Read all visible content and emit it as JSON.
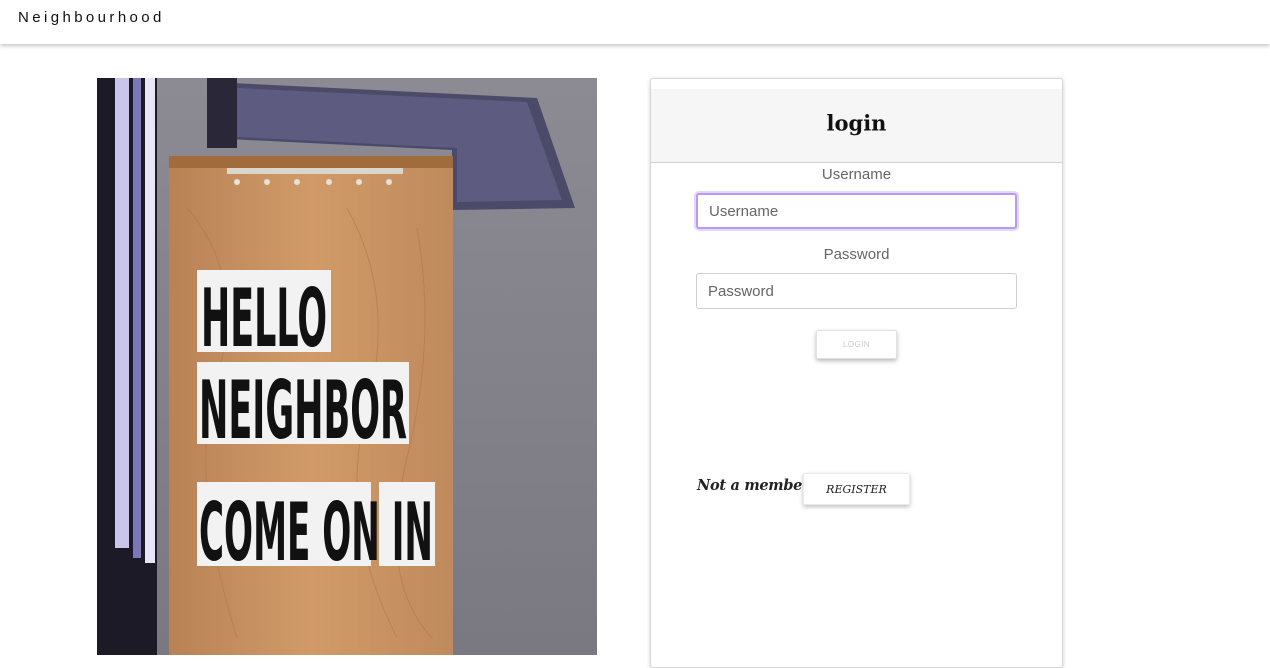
{
  "navbar": {
    "brand": "Neighbourhood"
  },
  "photo": {
    "sign_lines": [
      "HELLO",
      "NEIGHBOR",
      "COME ON IN"
    ]
  },
  "login_card": {
    "title": "login",
    "username": {
      "label": "Username",
      "placeholder": "Username",
      "value": ""
    },
    "password": {
      "label": "Password",
      "placeholder": "Password",
      "value": ""
    },
    "login_button": "LOGIN",
    "register_prompt": "Not a member?",
    "register_button": "REGISTER"
  },
  "colors": {
    "focus_border": "#b99af0",
    "header_bg": "#f6f6f6",
    "sign_wood": "#c9915e"
  }
}
